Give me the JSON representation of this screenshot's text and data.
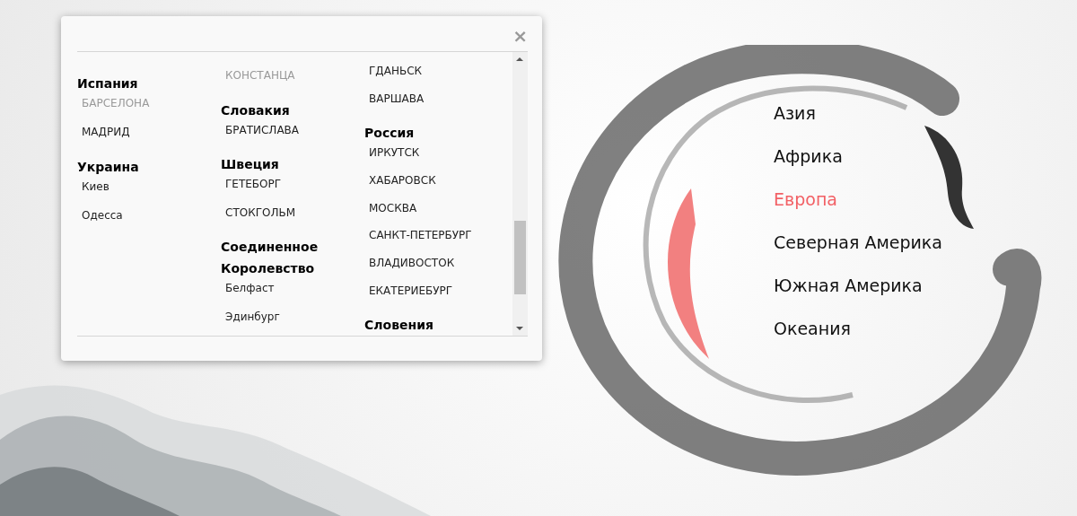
{
  "modal": {
    "close": "×",
    "columns": [
      {
        "groups": [
          {
            "heading": "Испания",
            "cities": [
              {
                "name": "БАРСЕЛОНА",
                "disabled": true
              },
              {
                "name": "МАДРИД",
                "disabled": false
              }
            ]
          },
          {
            "heading": "Украина",
            "cities": [
              {
                "name": "Киев",
                "disabled": false
              },
              {
                "name": "Одесса",
                "disabled": false
              }
            ]
          }
        ]
      },
      {
        "groups": [
          {
            "cities": [
              {
                "name": "КОНСТАНЦА",
                "disabled": true
              }
            ]
          },
          {
            "heading": "Словакия",
            "cities": [
              {
                "name": "БРАТИСЛАВА",
                "disabled": false
              }
            ]
          },
          {
            "heading": "Швеция",
            "cities": [
              {
                "name": "ГЕТЕБОРГ",
                "disabled": false
              },
              {
                "name": "СТОКГОЛЬМ",
                "disabled": false
              }
            ]
          },
          {
            "heading": "Соединенное Королевство",
            "cities": [
              {
                "name": "Белфаст",
                "disabled": false
              },
              {
                "name": "Эдинбург",
                "disabled": false
              }
            ]
          }
        ]
      },
      {
        "groups": [
          {
            "cities": [
              {
                "name": "ГДАНЬСК",
                "disabled": false
              },
              {
                "name": "ВАРШАВА",
                "disabled": false
              }
            ]
          },
          {
            "heading": "Россия",
            "cities": [
              {
                "name": "ИРКУТСК",
                "disabled": false
              },
              {
                "name": "ХАБАРОВСК",
                "disabled": false
              },
              {
                "name": "МОСКВА",
                "disabled": false
              },
              {
                "name": "САНКТ-ПЕТЕРБУРГ",
                "disabled": false
              },
              {
                "name": "ВЛАДИВОСТОК",
                "disabled": false
              },
              {
                "name": "ЕКАТЕРИЕБУРГ",
                "disabled": false
              }
            ]
          },
          {
            "heading": "Словения"
          }
        ]
      }
    ]
  },
  "continents": [
    {
      "label": "Азия",
      "selected": false
    },
    {
      "label": "Африка",
      "selected": false
    },
    {
      "label": "Европа",
      "selected": true
    },
    {
      "label": "Северная Америка",
      "selected": false
    },
    {
      "label": "Южная Америка",
      "selected": false
    },
    {
      "label": "Океания",
      "selected": false
    }
  ]
}
